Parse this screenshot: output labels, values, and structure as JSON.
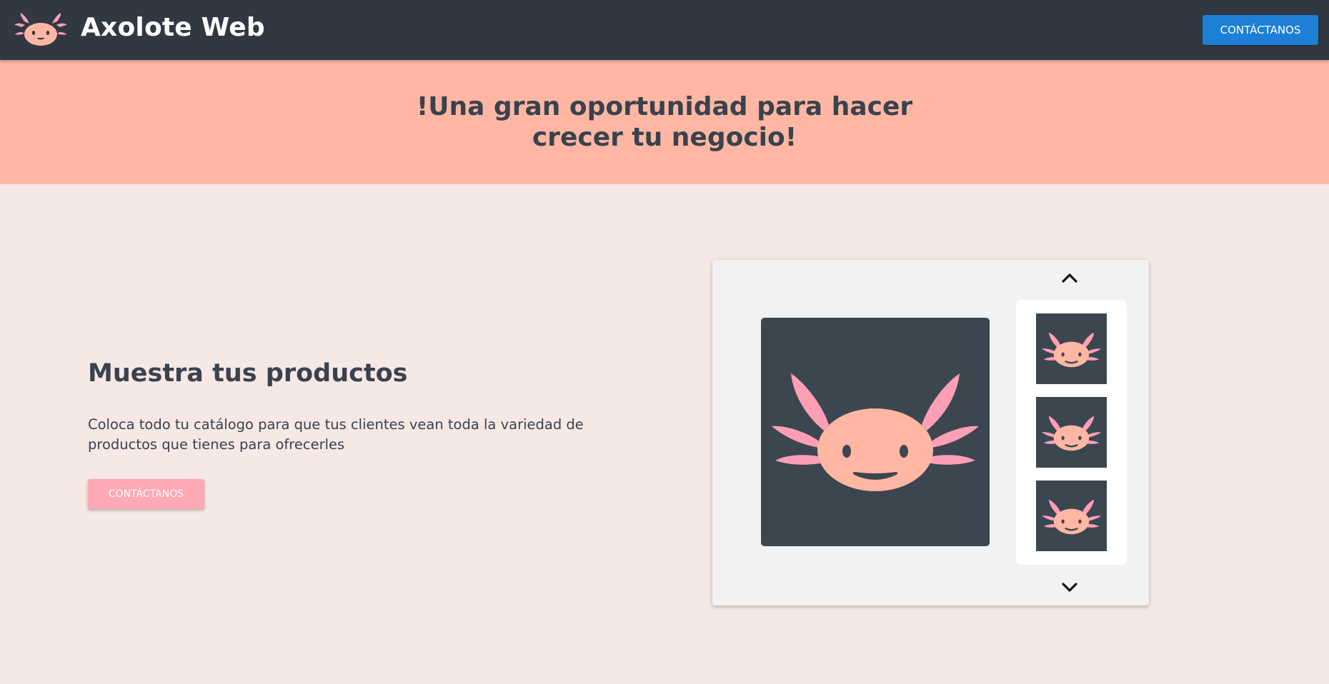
{
  "header": {
    "brand_name": "Axolote Web",
    "contact_button_label": "CONTÁCTANOS",
    "logo_icon": "axolotl-icon"
  },
  "banner": {
    "title": "!Una gran oportunidad para hacer crecer tu negocio!"
  },
  "feature": {
    "title": "Muestra tus productos",
    "description": "Coloca todo tu catálogo para que tus clientes vean toda la variedad de productos que tienes para ofrecerles",
    "contact_button_label": "CONTÁCTANOS"
  },
  "gallery": {
    "up_icon": "chevron-up-icon",
    "down_icon": "chevron-down-icon",
    "main_image_icon": "axolotl-icon",
    "thumbnails": [
      "axolotl-icon",
      "axolotl-icon",
      "axolotl-icon"
    ]
  },
  "colors": {
    "header_bg": "#313842",
    "banner_bg": "#ffb7a3",
    "page_bg": "#f6e8e5",
    "primary_button": "#1e7fd6",
    "secondary_button": "#ffa8b6",
    "axolotl_face": "#ffb7a3",
    "axolotl_gills": "#ff9fb5",
    "image_bg": "#3b4650"
  }
}
